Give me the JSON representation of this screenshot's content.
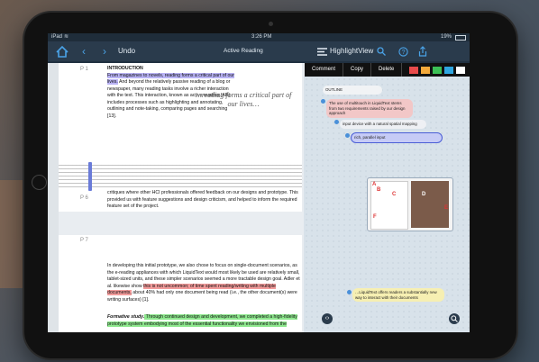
{
  "status": {
    "carrier": "iPad",
    "time": "3:26 PM",
    "battery": "19%"
  },
  "nav": {
    "undo": "Undo",
    "title": "Active Reading",
    "view": "HighlightView"
  },
  "popup": {
    "comment": "Comment",
    "copy": "Copy",
    "delete": "Delete",
    "colors": [
      "#e84b4b",
      "#f3a93b",
      "#3bbf55",
      "#2fa6e0",
      "#ffffff"
    ]
  },
  "doc": {
    "p1_label": "P 1",
    "heading": "INTRODUCTION",
    "p1_hl": "From magazines to novels, reading forms a critical part of our lives.",
    "p1_text": " And beyond the relatively passive reading of a blog or newspaper, many reading tasks involve a richer interaction with the text. This interaction, known as active reading (AR) includes processes such as highlighting and annotating, outlining and note-taking, comparing pages and searching [13].",
    "quote": "…reading forms a critical part of our lives…",
    "p6_label": "P 6",
    "p6_text": "critiques where other HCI professionals offered feedback on our designs and prototype. This provided us with feature suggestions and design criticism, and helped to inform the required feature set of the project.",
    "p7_label": "P 7",
    "p7_a": "In developing this initial prototype, we also chose to focus on single-document scenarios, as the e-reading appliances with which LiquidText would most likely be used are relatively small, tablet-sized units, and these simpler scenarios seemed a more tractable design goal. Adler et al. likewise show ",
    "p7_hl": "this is not uncommon; of time spent reading/writing with multiple documents,",
    "p7_b": " about 40% had only one document being read (i.e., the other document(s) were writing surfaces) [1].",
    "p8_bold": "Formative study.",
    "p8_hl": " Through continued design and development, we completed a high-fidelity prototype system embodying most of the essential functionality we envisioned from the"
  },
  "workspace": {
    "outline": "OUTLINE",
    "n1": "The use of multitouch in LiquidText stems from two requirements raised by our design approach",
    "n2": "input device with a natural spatial mapping",
    "n3": "rich, parallel input",
    "n4": "…LiquidText offers readers a substantially new way to interact with their documents",
    "thumb_letters": [
      "A",
      "B",
      "C",
      "D",
      "E",
      "F"
    ]
  }
}
